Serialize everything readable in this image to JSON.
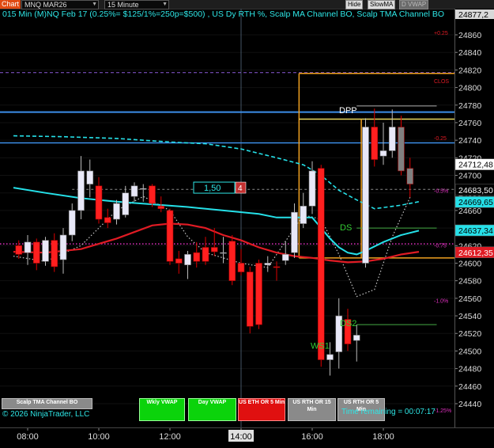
{
  "toolbar": {
    "chart_button": "Chart",
    "instrument": "MNQ MAR26",
    "interval": "15 Minute",
    "buttons": [
      {
        "label": "Hide",
        "enabled": true
      },
      {
        "label": "SlowMA",
        "enabled": true
      },
      {
        "label": "D VWAP",
        "enabled": false
      }
    ]
  },
  "chart": {
    "title": "015 Min (M)NQ Feb 17  (0.25%= $125/1%=250p=$500) , US Dy RTH %, Scalp MA Channel BO, Scalp TMA Channel BO",
    "copyright": "© 2026 NinjaTrader, LLC",
    "time_remaining": "Time remaining = 00:07:17",
    "colors": {
      "up": "#e8e8f8",
      "down": "#ff1f1f",
      "gray": "#808080",
      "cyan": "#25e0e8",
      "ma": "#e01b24",
      "blue_line": "#3d8ee8",
      "orange_box": "#f0a020",
      "yellow_line": "#e8d860"
    }
  },
  "buttons": [
    {
      "label": "Scalp TMA Channel BO",
      "style": "gray"
    },
    {
      "label": "Wkly VWAP",
      "style": "green"
    },
    {
      "label": "Day VWAP",
      "style": "green"
    },
    {
      "label": "US ETH OR 5 Min",
      "style": "red"
    },
    {
      "label": "US RTH OR 15 Min",
      "style": "gray"
    },
    {
      "label": "US RTH OR 5 Min",
      "style": "gray"
    }
  ],
  "annotations": {
    "dpp": "DPP",
    "ds": "DS",
    "ds2": "DS2",
    "ws1": "WS1",
    "clos": "CLOS",
    "pct_plus": "+0.25",
    "pct_1": "-0.25",
    "pct_2": "-0.5%",
    "pct_3": "-0.75",
    "pct_4": "-1.0%",
    "pct_5": "-1.25%",
    "order_qty": "1,50",
    "order_count": "4",
    "top_label": "24877,2"
  },
  "chart_data": {
    "type": "candlestick",
    "ylim": [
      24435,
      24880
    ],
    "y_ticks": [
      24860,
      24840,
      24820,
      24800,
      24780,
      24760,
      24740,
      24720,
      24700,
      24680,
      24660,
      24640,
      24620,
      24600,
      24580,
      24560,
      24540,
      24520,
      24500,
      24480,
      24460,
      24440
    ],
    "x_ticks": [
      {
        "label": "08:00",
        "hour": 8
      },
      {
        "label": "10:00",
        "hour": 10
      },
      {
        "label": "12:00",
        "hour": 12
      },
      {
        "label": "14:00",
        "hour": 14
      },
      {
        "label": "16:00",
        "hour": 16
      },
      {
        "label": "18:00",
        "hour": 18
      }
    ],
    "crosshair_time": "14:00",
    "price_tags": [
      {
        "value": 24712.48,
        "label": "24712,48",
        "bg": "#ffffff",
        "fg": "#000000"
      },
      {
        "value": 24683.5,
        "label": "24683,50",
        "bg": "#000000",
        "fg": "#ffffff"
      },
      {
        "value": 24669.65,
        "label": "24669,65",
        "bg": "#25e0e8",
        "fg": "#000000"
      },
      {
        "value": 24637.34,
        "label": "24637,34",
        "bg": "#25e0e8",
        "fg": "#000000"
      },
      {
        "value": 24612.35,
        "label": "24612,35",
        "bg": "#e01b24",
        "fg": "#ffffff"
      }
    ],
    "levels": {
      "purple_dash": 24817,
      "blue_top": 24772,
      "blue_mid": 24737,
      "yellow_top": 24764,
      "orange_bottom": 24606,
      "magenta_dot": 24622,
      "gray_dash": 24684
    },
    "candles": [
      {
        "t": 7.75,
        "o": 24620,
        "h": 24626,
        "l": 24605,
        "c": 24610
      },
      {
        "t": 8.0,
        "o": 24612,
        "h": 24632,
        "l": 24598,
        "c": 24624
      },
      {
        "t": 8.25,
        "o": 24624,
        "h": 24628,
        "l": 24592,
        "c": 24600
      },
      {
        "t": 8.5,
        "o": 24602,
        "h": 24630,
        "l": 24597,
        "c": 24626
      },
      {
        "t": 8.75,
        "o": 24626,
        "h": 24634,
        "l": 24590,
        "c": 24596
      },
      {
        "t": 9.0,
        "o": 24604,
        "h": 24640,
        "l": 24588,
        "c": 24632
      },
      {
        "t": 9.25,
        "o": 24632,
        "h": 24668,
        "l": 24625,
        "c": 24660
      },
      {
        "t": 9.5,
        "o": 24660,
        "h": 24722,
        "l": 24650,
        "c": 24705
      },
      {
        "t": 9.75,
        "o": 24690,
        "h": 24718,
        "l": 24675,
        "c": 24705
      },
      {
        "t": 10.0,
        "o": 24688,
        "h": 24698,
        "l": 24645,
        "c": 24650
      },
      {
        "t": 10.25,
        "o": 24652,
        "h": 24662,
        "l": 24640,
        "c": 24646
      },
      {
        "t": 10.5,
        "o": 24650,
        "h": 24672,
        "l": 24644,
        "c": 24668
      },
      {
        "t": 10.75,
        "o": 24655,
        "h": 24688,
        "l": 24652,
        "c": 24680
      },
      {
        "t": 11.0,
        "o": 24676,
        "h": 24692,
        "l": 24670,
        "c": 24688
      },
      {
        "t": 11.25,
        "o": 24684,
        "h": 24690,
        "l": 24670,
        "c": 24685
      },
      {
        "t": 11.5,
        "o": 24688,
        "h": 24690,
        "l": 24664,
        "c": 24668
      },
      {
        "t": 11.75,
        "o": 24665,
        "h": 24676,
        "l": 24658,
        "c": 24662
      },
      {
        "t": 12.0,
        "o": 24660,
        "h": 24662,
        "l": 24598,
        "c": 24602
      },
      {
        "t": 12.25,
        "o": 24605,
        "h": 24614,
        "l": 24588,
        "c": 24600
      },
      {
        "t": 12.5,
        "o": 24598,
        "h": 24614,
        "l": 24582,
        "c": 24610
      },
      {
        "t": 12.75,
        "o": 24612,
        "h": 24624,
        "l": 24595,
        "c": 24602
      },
      {
        "t": 13.0,
        "o": 24618,
        "h": 24630,
        "l": 24598,
        "c": 24602
      },
      {
        "t": 13.25,
        "o": 24618,
        "h": 24640,
        "l": 24608,
        "c": 24613
      },
      {
        "t": 13.5,
        "o": 24612,
        "h": 24630,
        "l": 24600,
        "c": 24612
      },
      {
        "t": 13.75,
        "o": 24625,
        "h": 24632,
        "l": 24575,
        "c": 24580
      },
      {
        "t": 14.0,
        "o": 24600,
        "h": 24616,
        "l": 24586,
        "c": 24590
      },
      {
        "t": 14.25,
        "o": 24590,
        "h": 24596,
        "l": 24520,
        "c": 24528
      },
      {
        "t": 14.5,
        "o": 24600,
        "h": 24604,
        "l": 24525,
        "c": 24530
      },
      {
        "t": 14.75,
        "o": 24598,
        "h": 24608,
        "l": 24590,
        "c": 24600
      },
      {
        "t": 15.0,
        "o": 24596,
        "h": 24602,
        "l": 24580,
        "c": 24595
      },
      {
        "t": 15.25,
        "o": 24603,
        "h": 24625,
        "l": 24598,
        "c": 24610
      },
      {
        "t": 15.5,
        "o": 24612,
        "h": 24668,
        "l": 24606,
        "c": 24658
      },
      {
        "t": 15.75,
        "o": 24645,
        "h": 24680,
        "l": 24640,
        "c": 24665
      },
      {
        "t": 16.0,
        "o": 24665,
        "h": 24716,
        "l": 24656,
        "c": 24705
      },
      {
        "t": 16.25,
        "o": 24708,
        "h": 24712,
        "l": 24482,
        "c": 24490
      },
      {
        "t": 16.5,
        "o": 24490,
        "h": 24510,
        "l": 24472,
        "c": 24496
      },
      {
        "t": 16.75,
        "o": 24499,
        "h": 24560,
        "l": 24480,
        "c": 24540
      },
      {
        "t": 17.0,
        "o": 24536,
        "h": 24548,
        "l": 24500,
        "c": 24508
      },
      {
        "t": 17.25,
        "o": 24512,
        "h": 24530,
        "l": 24488,
        "c": 24518
      },
      {
        "t": 17.5,
        "o": 24600,
        "h": 24765,
        "l": 24595,
        "c": 24755
      },
      {
        "t": 17.75,
        "o": 24755,
        "h": 24776,
        "l": 24710,
        "c": 24718
      },
      {
        "t": 18.0,
        "o": 24722,
        "h": 24760,
        "l": 24712,
        "c": 24728
      },
      {
        "t": 18.25,
        "o": 24728,
        "h": 24775,
        "l": 24720,
        "c": 24755
      },
      {
        "t": 18.5,
        "o": 24755,
        "h": 24768,
        "l": 24700,
        "c": 24705
      },
      {
        "t": 18.75,
        "o": 24708,
        "h": 24720,
        "l": 24675,
        "c": 24690
      }
    ],
    "cyan_solid": [
      [
        7.6,
        24686
      ],
      [
        8.5,
        24680
      ],
      [
        9.5,
        24674
      ],
      [
        10.5,
        24670
      ],
      [
        11.5,
        24667
      ],
      [
        12.5,
        24664
      ],
      [
        13.5,
        24660
      ],
      [
        14.5,
        24656
      ],
      [
        15.0,
        24652
      ],
      [
        15.5,
        24652
      ],
      [
        16.0,
        24652
      ],
      [
        16.25,
        24640
      ],
      [
        16.5,
        24628
      ],
      [
        16.75,
        24618
      ],
      [
        17.0,
        24612
      ],
      [
        17.25,
        24610
      ],
      [
        17.5,
        24614
      ],
      [
        18.0,
        24624
      ],
      [
        18.5,
        24632
      ],
      [
        19.0,
        24637
      ]
    ],
    "cyan_dashed": [
      [
        7.6,
        24745
      ],
      [
        9.0,
        24744
      ],
      [
        10.5,
        24742
      ],
      [
        12.0,
        24738
      ],
      [
        13.0,
        24736
      ],
      [
        14.0,
        24730
      ],
      [
        15.0,
        24720
      ],
      [
        15.75,
        24712
      ],
      [
        16.25,
        24700
      ],
      [
        16.75,
        24683
      ],
      [
        17.25,
        24672
      ],
      [
        17.75,
        24662
      ],
      [
        18.5,
        24666
      ],
      [
        19.0,
        24670
      ]
    ],
    "ma_red": [
      [
        7.6,
        24613
      ],
      [
        8.5,
        24612
      ],
      [
        9.5,
        24616
      ],
      [
        10.5,
        24628
      ],
      [
        11.5,
        24643
      ],
      [
        12.0,
        24645
      ],
      [
        12.5,
        24644
      ],
      [
        13.0,
        24640
      ],
      [
        13.5,
        24632
      ],
      [
        14.0,
        24626
      ],
      [
        14.5,
        24618
      ],
      [
        15.0,
        24612
      ],
      [
        15.5,
        24608
      ],
      [
        16.0,
        24606
      ],
      [
        16.5,
        24603
      ],
      [
        17.0,
        24601
      ],
      [
        17.5,
        24602
      ],
      [
        18.0,
        24605
      ],
      [
        18.5,
        24610
      ],
      [
        19.0,
        24613
      ]
    ],
    "white_dotted": [
      [
        7.6,
        24608
      ],
      [
        8.5,
        24602
      ],
      [
        9.5,
        24620
      ],
      [
        10.0,
        24640
      ],
      [
        10.5,
        24660
      ],
      [
        11.25,
        24676
      ],
      [
        12.0,
        24660
      ],
      [
        12.5,
        24630
      ],
      [
        13.0,
        24612
      ],
      [
        14.0,
        24600
      ],
      [
        14.75,
        24595
      ],
      [
        15.25,
        24625
      ],
      [
        15.75,
        24655
      ],
      [
        16.25,
        24650
      ],
      [
        16.75,
        24610
      ],
      [
        17.25,
        24562
      ],
      [
        17.75,
        24570
      ],
      [
        18.25,
        24630
      ],
      [
        18.75,
        24675
      ]
    ]
  }
}
